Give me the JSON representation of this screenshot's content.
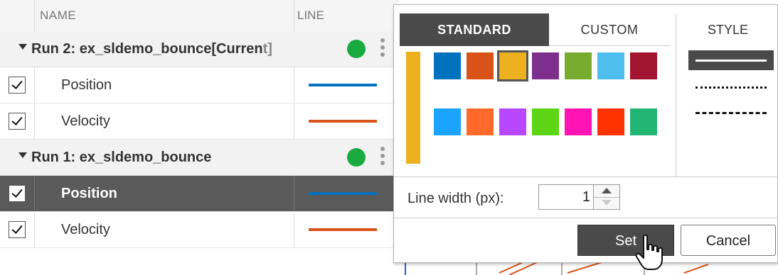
{
  "table": {
    "headers": {
      "name": "NAME",
      "line": "LINE"
    },
    "runs": [
      {
        "name": "Run 2: ex_sldemo_bounce[Curren",
        "name_clipped": "t]",
        "status_color": "#1aab40",
        "signals": [
          {
            "name": "Position",
            "checked": true,
            "selected": false,
            "line_color": "#0072bd"
          },
          {
            "name": "Velocity",
            "checked": true,
            "selected": false,
            "line_color": "#d95319"
          }
        ]
      },
      {
        "name": "Run 1: ex_sldemo_bounce",
        "status_color": "#1aab40",
        "signals": [
          {
            "name": "Position",
            "checked": true,
            "selected": true,
            "line_color": "#0072bd"
          },
          {
            "name": "Velocity",
            "checked": true,
            "selected": false,
            "line_color": "#d95319"
          }
        ]
      }
    ]
  },
  "popup": {
    "tabs": {
      "standard": "STANDARD",
      "custom": "CUSTOM",
      "style": "STYLE"
    },
    "current_color": "#edb120",
    "standard_colors_row1": [
      "#0072bd",
      "#d95319",
      "#edb120",
      "#7e2f8e",
      "#77ac30",
      "#4dbeee",
      "#a2142f"
    ],
    "standard_colors_row2": [
      "#1aa3ff",
      "#ff6929",
      "#b847ff",
      "#5cd614",
      "#ff14b3",
      "#ff3300",
      "#21b573"
    ],
    "selected_color": "#edb120",
    "line_styles": [
      "solid",
      "dotted",
      "dashed",
      "dash-dot"
    ],
    "selected_style": "solid",
    "line_width": {
      "label": "Line width (px):",
      "value": "1"
    },
    "buttons": {
      "set": "Set",
      "cancel": "Cancel"
    }
  }
}
